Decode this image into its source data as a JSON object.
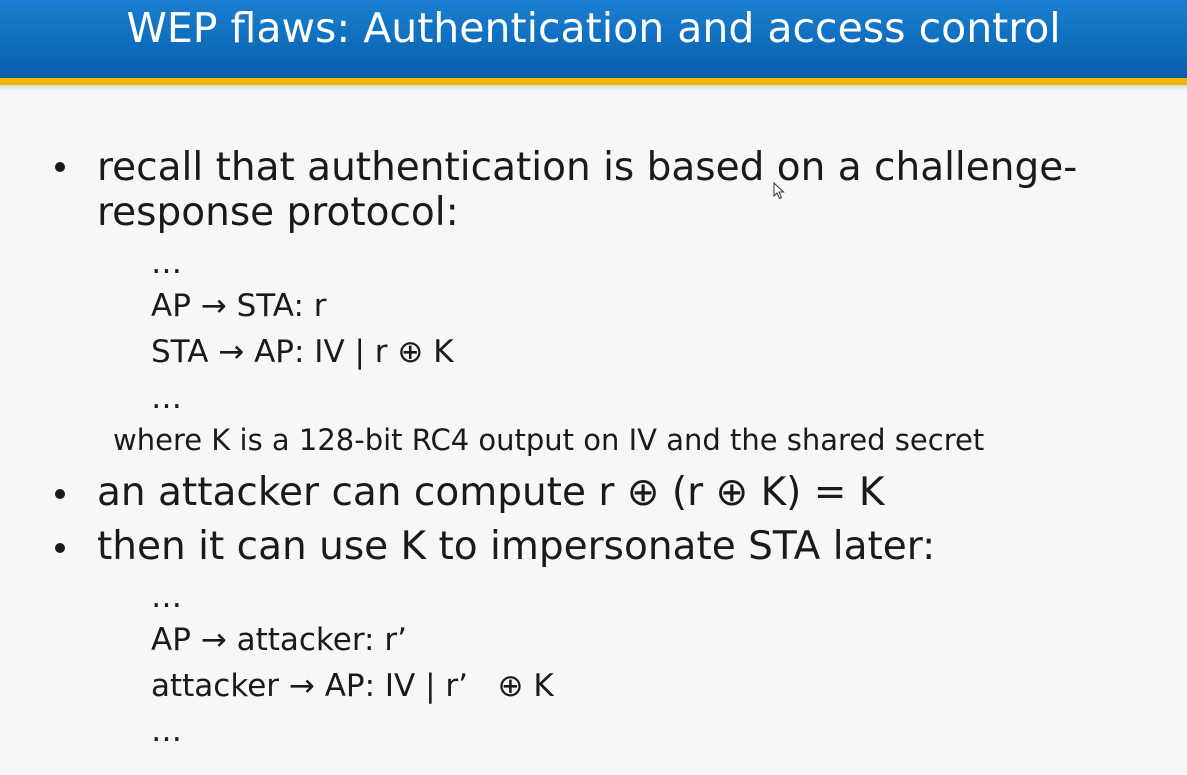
{
  "slide": {
    "title": "WEP flaws: Authentication and access control",
    "bullets": [
      {
        "lines": [
          "recall that authentication is based on a challenge-",
          "response protocol:"
        ]
      },
      {
        "lines": [
          "an attacker can compute r ⊕ (r ⊕ K) = K"
        ]
      },
      {
        "lines": [
          "then it can use K to impersonate STA later:"
        ]
      }
    ],
    "protocol_1": [
      "…",
      "AP → STA: r",
      "STA → AP: IV | r ⊕ K",
      "…"
    ],
    "note": "where K is a 128-bit RC4 output on IV and the shared secret",
    "protocol_2": [
      "…",
      "AP → attacker: r’",
      "attacker → AP: IV | r’   ⊕ K",
      "…"
    ]
  },
  "colors": {
    "title_bar": "#0f6dbd",
    "title_accent": "#f2b800",
    "background": "#f7f7f7",
    "text": "#1a1a1a"
  },
  "icons": {
    "cursor": "mouse-pointer-icon"
  }
}
